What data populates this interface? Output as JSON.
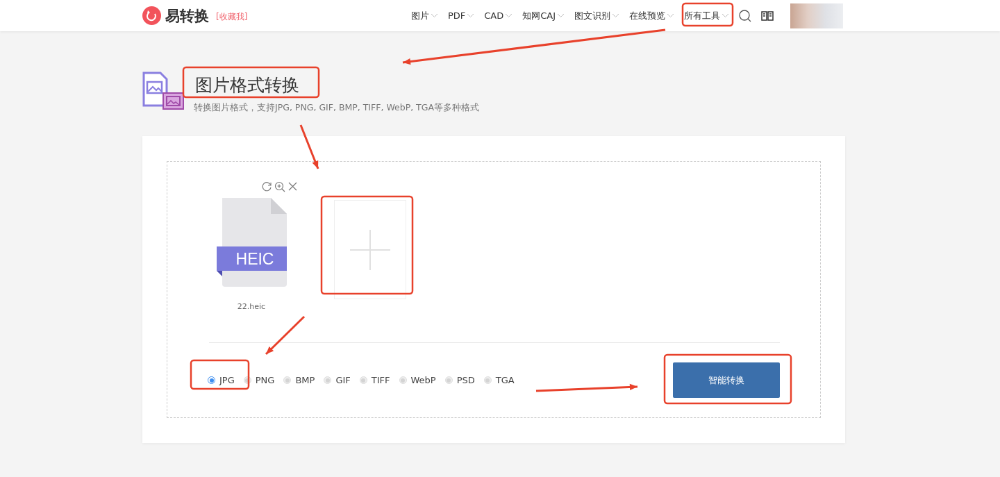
{
  "header": {
    "logo": "易转换",
    "bookmark": "[收藏我]",
    "nav": [
      {
        "label": "图片"
      },
      {
        "label": "PDF"
      },
      {
        "label": "CAD"
      },
      {
        "label": "知网CAJ"
      },
      {
        "label": "图文识别"
      },
      {
        "label": "在线预览"
      },
      {
        "label": "所有工具"
      }
    ]
  },
  "page": {
    "title": "图片格式转换",
    "subtitle": "转换图片格式，支持JPG, PNG, GIF, BMP, TIFF, WebP, TGA等多种格式"
  },
  "upload": {
    "files": [
      {
        "badge": "HEIC",
        "name": "22.heic"
      }
    ]
  },
  "formats": [
    {
      "label": "JPG",
      "selected": true
    },
    {
      "label": "PNG",
      "selected": false
    },
    {
      "label": "BMP",
      "selected": false
    },
    {
      "label": "GIF",
      "selected": false
    },
    {
      "label": "TIFF",
      "selected": false
    },
    {
      "label": "WebP",
      "selected": false
    },
    {
      "label": "PSD",
      "selected": false
    },
    {
      "label": "TGA",
      "selected": false
    }
  ],
  "convert_button": "智能转换"
}
